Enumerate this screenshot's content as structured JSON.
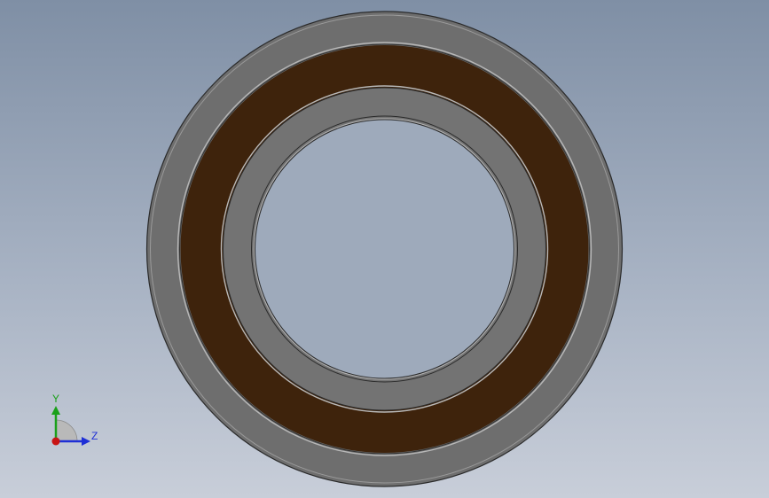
{
  "colors": {
    "background_top": "#7f8fa5",
    "background_bottom": "#c8ced9",
    "race_gray": "#6e6e6e",
    "race_gray_inner": "#737373",
    "seal_brown": "#3e230c",
    "edge_line": "#2a2a2a",
    "highlight_line": "#b4b4b4",
    "axis_y": "#1aa01a",
    "axis_z": "#1e2fd6",
    "axis_x": "#c81414"
  },
  "triad": {
    "y_label": "Y",
    "z_label": "Z"
  }
}
